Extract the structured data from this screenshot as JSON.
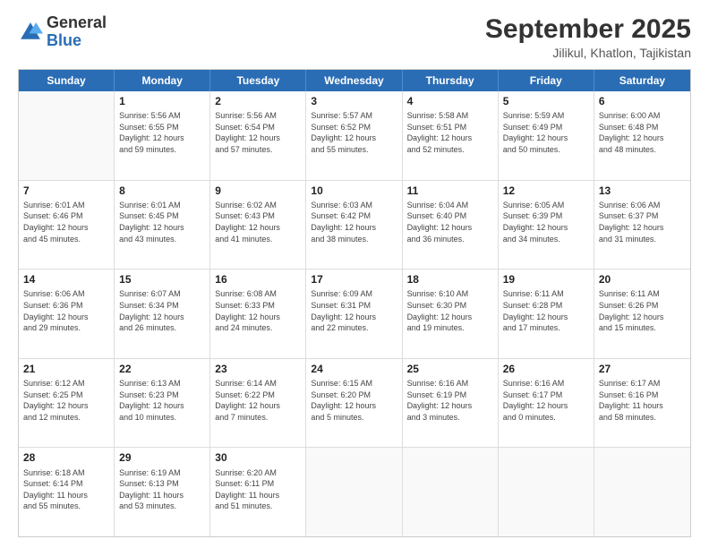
{
  "logo": {
    "general": "General",
    "blue": "Blue"
  },
  "header": {
    "month_year": "September 2025",
    "location": "Jilikul, Khatlon, Tajikistan"
  },
  "days_of_week": [
    "Sunday",
    "Monday",
    "Tuesday",
    "Wednesday",
    "Thursday",
    "Friday",
    "Saturday"
  ],
  "weeks": [
    [
      {
        "day": "",
        "info": ""
      },
      {
        "day": "1",
        "info": "Sunrise: 5:56 AM\nSunset: 6:55 PM\nDaylight: 12 hours\nand 59 minutes."
      },
      {
        "day": "2",
        "info": "Sunrise: 5:56 AM\nSunset: 6:54 PM\nDaylight: 12 hours\nand 57 minutes."
      },
      {
        "day": "3",
        "info": "Sunrise: 5:57 AM\nSunset: 6:52 PM\nDaylight: 12 hours\nand 55 minutes."
      },
      {
        "day": "4",
        "info": "Sunrise: 5:58 AM\nSunset: 6:51 PM\nDaylight: 12 hours\nand 52 minutes."
      },
      {
        "day": "5",
        "info": "Sunrise: 5:59 AM\nSunset: 6:49 PM\nDaylight: 12 hours\nand 50 minutes."
      },
      {
        "day": "6",
        "info": "Sunrise: 6:00 AM\nSunset: 6:48 PM\nDaylight: 12 hours\nand 48 minutes."
      }
    ],
    [
      {
        "day": "7",
        "info": "Sunrise: 6:01 AM\nSunset: 6:46 PM\nDaylight: 12 hours\nand 45 minutes."
      },
      {
        "day": "8",
        "info": "Sunrise: 6:01 AM\nSunset: 6:45 PM\nDaylight: 12 hours\nand 43 minutes."
      },
      {
        "day": "9",
        "info": "Sunrise: 6:02 AM\nSunset: 6:43 PM\nDaylight: 12 hours\nand 41 minutes."
      },
      {
        "day": "10",
        "info": "Sunrise: 6:03 AM\nSunset: 6:42 PM\nDaylight: 12 hours\nand 38 minutes."
      },
      {
        "day": "11",
        "info": "Sunrise: 6:04 AM\nSunset: 6:40 PM\nDaylight: 12 hours\nand 36 minutes."
      },
      {
        "day": "12",
        "info": "Sunrise: 6:05 AM\nSunset: 6:39 PM\nDaylight: 12 hours\nand 34 minutes."
      },
      {
        "day": "13",
        "info": "Sunrise: 6:06 AM\nSunset: 6:37 PM\nDaylight: 12 hours\nand 31 minutes."
      }
    ],
    [
      {
        "day": "14",
        "info": "Sunrise: 6:06 AM\nSunset: 6:36 PM\nDaylight: 12 hours\nand 29 minutes."
      },
      {
        "day": "15",
        "info": "Sunrise: 6:07 AM\nSunset: 6:34 PM\nDaylight: 12 hours\nand 26 minutes."
      },
      {
        "day": "16",
        "info": "Sunrise: 6:08 AM\nSunset: 6:33 PM\nDaylight: 12 hours\nand 24 minutes."
      },
      {
        "day": "17",
        "info": "Sunrise: 6:09 AM\nSunset: 6:31 PM\nDaylight: 12 hours\nand 22 minutes."
      },
      {
        "day": "18",
        "info": "Sunrise: 6:10 AM\nSunset: 6:30 PM\nDaylight: 12 hours\nand 19 minutes."
      },
      {
        "day": "19",
        "info": "Sunrise: 6:11 AM\nSunset: 6:28 PM\nDaylight: 12 hours\nand 17 minutes."
      },
      {
        "day": "20",
        "info": "Sunrise: 6:11 AM\nSunset: 6:26 PM\nDaylight: 12 hours\nand 15 minutes."
      }
    ],
    [
      {
        "day": "21",
        "info": "Sunrise: 6:12 AM\nSunset: 6:25 PM\nDaylight: 12 hours\nand 12 minutes."
      },
      {
        "day": "22",
        "info": "Sunrise: 6:13 AM\nSunset: 6:23 PM\nDaylight: 12 hours\nand 10 minutes."
      },
      {
        "day": "23",
        "info": "Sunrise: 6:14 AM\nSunset: 6:22 PM\nDaylight: 12 hours\nand 7 minutes."
      },
      {
        "day": "24",
        "info": "Sunrise: 6:15 AM\nSunset: 6:20 PM\nDaylight: 12 hours\nand 5 minutes."
      },
      {
        "day": "25",
        "info": "Sunrise: 6:16 AM\nSunset: 6:19 PM\nDaylight: 12 hours\nand 3 minutes."
      },
      {
        "day": "26",
        "info": "Sunrise: 6:16 AM\nSunset: 6:17 PM\nDaylight: 12 hours\nand 0 minutes."
      },
      {
        "day": "27",
        "info": "Sunrise: 6:17 AM\nSunset: 6:16 PM\nDaylight: 11 hours\nand 58 minutes."
      }
    ],
    [
      {
        "day": "28",
        "info": "Sunrise: 6:18 AM\nSunset: 6:14 PM\nDaylight: 11 hours\nand 55 minutes."
      },
      {
        "day": "29",
        "info": "Sunrise: 6:19 AM\nSunset: 6:13 PM\nDaylight: 11 hours\nand 53 minutes."
      },
      {
        "day": "30",
        "info": "Sunrise: 6:20 AM\nSunset: 6:11 PM\nDaylight: 11 hours\nand 51 minutes."
      },
      {
        "day": "",
        "info": ""
      },
      {
        "day": "",
        "info": ""
      },
      {
        "day": "",
        "info": ""
      },
      {
        "day": "",
        "info": ""
      }
    ]
  ]
}
